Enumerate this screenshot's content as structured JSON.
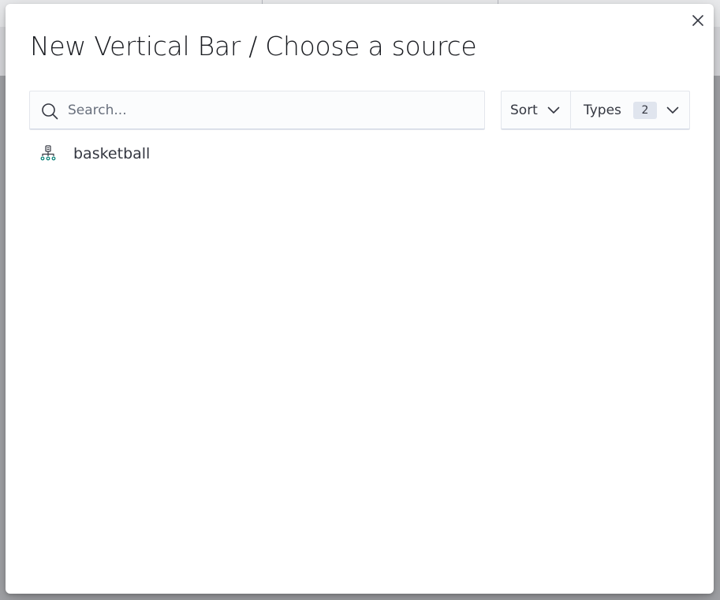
{
  "modal": {
    "title": "New Vertical Bar / Choose a source",
    "close_icon": "close-icon"
  },
  "search": {
    "placeholder": "Search...",
    "value": "",
    "icon": "search-icon"
  },
  "filters": {
    "sort_label": "Sort",
    "types_label": "Types",
    "types_count": "2",
    "chevron_icon": "chevron-down-icon"
  },
  "sources": [
    {
      "label": "basketball",
      "icon": "index-pattern-icon"
    }
  ],
  "colors": {
    "accent": "#006bb8",
    "index_icon": "#017d73",
    "text": "#343741",
    "title": "#1a1c21",
    "badge_bg": "#e0e5ee"
  }
}
